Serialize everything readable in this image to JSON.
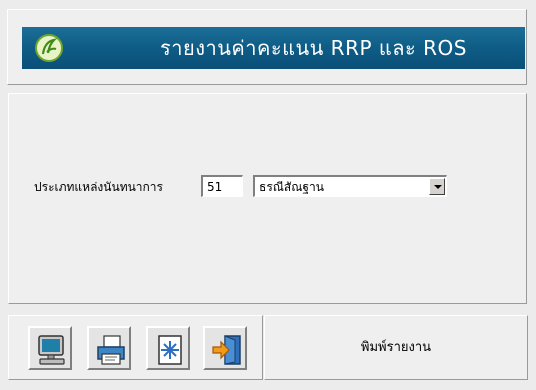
{
  "header": {
    "title": "รายงานค่าคะแนน RRP และ ROS",
    "logo_icon": "app-logo-icon",
    "accent": "#0f5e88"
  },
  "form": {
    "field_label": "ประเภทแหล่งนันทนาการ",
    "code_value": "51",
    "type_selected": "ธรณีสัณฐาน"
  },
  "toolbar": {
    "buttons": [
      {
        "icon": "monitor-icon"
      },
      {
        "icon": "printer-icon"
      },
      {
        "icon": "refresh-icon"
      },
      {
        "icon": "exit-icon"
      }
    ]
  },
  "status": {
    "text": "พิมพ์รายงาน"
  }
}
